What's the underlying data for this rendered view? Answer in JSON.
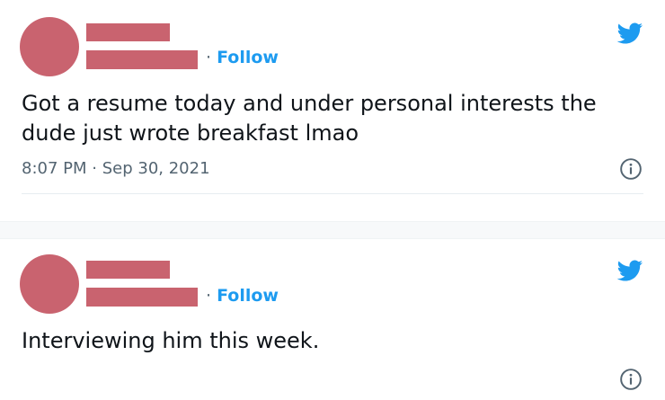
{
  "tweets": [
    {
      "follow_dot": "·",
      "follow_label": "Follow",
      "text": "Got a resume today and under personal interests the dude just wrote breakfast lmao",
      "time": "8:07 PM",
      "meta_dot": "·",
      "date": "Sep 30, 2021",
      "icons": [
        "twitter-bird-icon",
        "info-icon"
      ]
    },
    {
      "follow_dot": "·",
      "follow_label": "Follow",
      "text": "Interviewing him this week.",
      "icons": [
        "twitter-bird-icon",
        "info-icon"
      ]
    }
  ],
  "colors": {
    "redaction": "#c9636f",
    "accent": "#1d9bf0",
    "secondary_text": "#536471"
  }
}
